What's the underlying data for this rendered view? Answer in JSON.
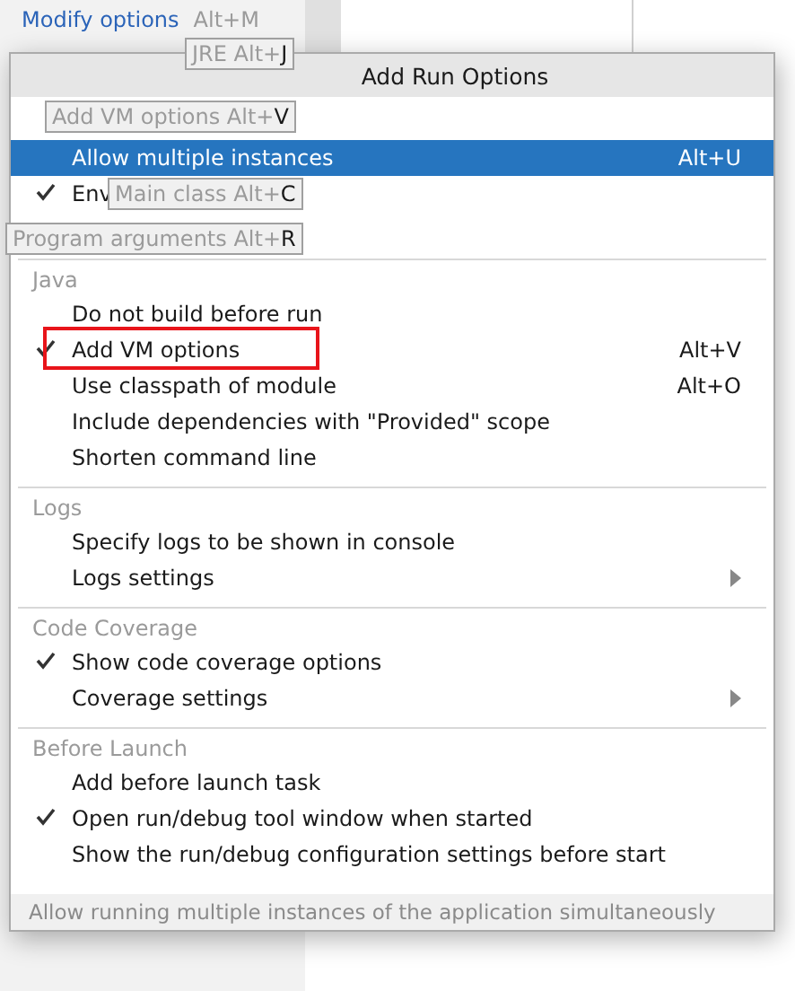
{
  "background": {
    "modify_options": {
      "label": "Modify options",
      "shortcut": "Alt+M"
    }
  },
  "menu": {
    "title": "Add Run Options",
    "sections": [
      {
        "items": [
          {
            "label": "Allow multiple instances",
            "shortcut": "Alt+U",
            "checked": false,
            "selected": true,
            "submenu": false,
            "highlighted": false
          },
          {
            "label": "Env",
            "checked": true,
            "selected": false,
            "submenu": false,
            "highlighted": false
          }
        ]
      },
      {
        "header": "Java",
        "items": [
          {
            "label": "Do not build before run",
            "checked": false,
            "selected": false,
            "submenu": false,
            "highlighted": false
          },
          {
            "label": "Add VM options",
            "shortcut": "Alt+V",
            "checked": true,
            "selected": false,
            "submenu": false,
            "highlighted": true
          },
          {
            "label": "Use classpath of module",
            "shortcut": "Alt+O",
            "checked": false,
            "selected": false,
            "submenu": false,
            "highlighted": false
          },
          {
            "label": "Include dependencies with \"Provided\" scope",
            "checked": false,
            "selected": false,
            "submenu": false,
            "highlighted": false
          },
          {
            "label": "Shorten command line",
            "checked": false,
            "selected": false,
            "submenu": false,
            "highlighted": false
          }
        ]
      },
      {
        "header": "Logs",
        "items": [
          {
            "label": "Specify logs to be shown in console",
            "checked": false,
            "selected": false,
            "submenu": false,
            "highlighted": false
          },
          {
            "label": "Logs settings",
            "checked": false,
            "selected": false,
            "submenu": true,
            "highlighted": false
          }
        ]
      },
      {
        "header": "Code Coverage",
        "items": [
          {
            "label": "Show code coverage options",
            "checked": true,
            "selected": false,
            "submenu": false,
            "highlighted": false
          },
          {
            "label": "Coverage settings",
            "checked": false,
            "selected": false,
            "submenu": true,
            "highlighted": false
          }
        ]
      },
      {
        "header": "Before Launch",
        "items": [
          {
            "label": "Add before launch task",
            "checked": false,
            "selected": false,
            "submenu": false,
            "highlighted": false
          },
          {
            "label": "Open run/debug tool window when started",
            "checked": true,
            "selected": false,
            "submenu": false,
            "highlighted": false
          },
          {
            "label": "Show the run/debug configuration settings before start",
            "checked": false,
            "selected": false,
            "submenu": false,
            "highlighted": false
          }
        ]
      }
    ],
    "status": "Allow running multiple instances of the application simultaneously"
  },
  "hints": [
    {
      "text": "JRE Alt+",
      "key": "J"
    },
    {
      "text": "Add VM options Alt+",
      "key": "V"
    },
    {
      "text": "Main class Alt+",
      "key": "C"
    },
    {
      "text": "Program arguments Alt+",
      "key": "R"
    }
  ]
}
